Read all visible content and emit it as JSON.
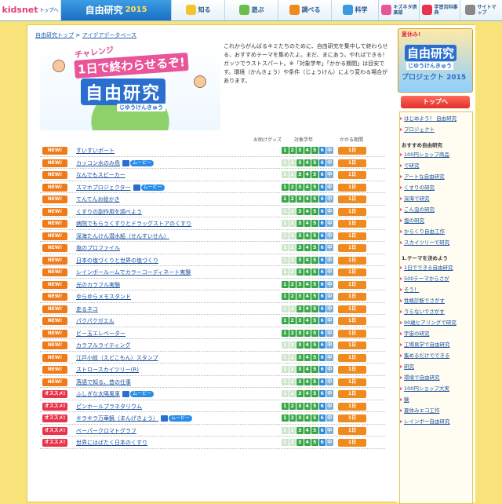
{
  "header": {
    "logo": "kidsnet",
    "logo_sub": "トップへ",
    "site_title": "自由研究",
    "site_year": "2015",
    "nav": [
      {
        "label": "知る",
        "icon": "book-icon",
        "color": "#f4c430"
      },
      {
        "label": "遊ぶ",
        "icon": "game-icon",
        "color": "#6abf4b"
      },
      {
        "label": "調べる",
        "icon": "search-icon",
        "color": "#f08a1e"
      },
      {
        "label": "科学",
        "icon": "flask-icon",
        "color": "#3a9be0"
      },
      {
        "label": "キズネタ倶楽部",
        "icon": "club-icon",
        "color": "#e85598"
      },
      {
        "label": "学習百科事典",
        "icon": "encyclopedia-icon",
        "color": "#e8334a"
      },
      {
        "label": "サイトマップ",
        "icon": "map-icon",
        "color": "#888888"
      }
    ]
  },
  "breadcrumb": {
    "home": "自由研究トップ",
    "sep": " > ",
    "current": "アイデアデータベース"
  },
  "banner": {
    "challenge": "チャレンジ",
    "line1": "1日で終わらせるぞ!",
    "line2": "自由研究",
    "ruby": "じゆうけんきゅう"
  },
  "intro": "これからがんばるキミたちのために、自由研究を集中して終わらせる、おすすめテーマを集めたよ。まだ、まにあう。やればできる！ ガッツでラストスパート。※「対象学年」「かかる期間」は目安です。環境（かんきょう）や条件（じょうけん）により変わる場合があります。",
  "columns": {
    "goods": "お助けグッズ",
    "grade": "対象学年",
    "period": "かかる期間"
  },
  "rows": [
    {
      "tag": "NEW!",
      "type": "new",
      "title": "すいすいボート",
      "movie": "",
      "grades": [
        1,
        2,
        3,
        4,
        5,
        6
      ],
      "period": "1日"
    },
    {
      "tag": "NEW!",
      "type": "new",
      "title": "カッコン水のみ鳥",
      "movie": "ムービー",
      "grades": [
        3,
        4,
        5,
        6
      ],
      "period": "1日"
    },
    {
      "tag": "NEW!",
      "type": "new",
      "title": "なんでもスピーカー",
      "movie": "",
      "grades": [
        3,
        4,
        5,
        6
      ],
      "period": "1日"
    },
    {
      "tag": "NEW!",
      "type": "new",
      "title": "スマホプロジェクター",
      "movie": "ムービー",
      "grades": [
        1,
        2,
        3,
        4,
        5,
        6
      ],
      "period": "1日"
    },
    {
      "tag": "NEW!",
      "type": "new",
      "title": "てんてんお絵かき",
      "movie": "",
      "grades": [
        1,
        2,
        3,
        4,
        5,
        6
      ],
      "period": "1日"
    },
    {
      "tag": "NEW!",
      "type": "new",
      "title": "くすりの副作用を調べよう",
      "movie": "",
      "grades": [
        3,
        4,
        5,
        6
      ],
      "period": "1日"
    },
    {
      "tag": "NEW!",
      "type": "new",
      "title": "病院でもらうくすりとドラッグストアのくすり",
      "movie": "",
      "grades": [
        3,
        4,
        5,
        6
      ],
      "period": "1日"
    },
    {
      "tag": "NEW!",
      "type": "new",
      "title": "深海たんけん潜水船（せんすいせん）",
      "movie": "",
      "grades": [
        3,
        4,
        5,
        6
      ],
      "period": "1日"
    },
    {
      "tag": "NEW!",
      "type": "new",
      "title": "塩のプロファイル",
      "movie": "",
      "grades": [
        3,
        4,
        5,
        6
      ],
      "period": "1日"
    },
    {
      "tag": "NEW!",
      "type": "new",
      "title": "日本の塩づくりと世界の塩づくり",
      "movie": "",
      "grades": [
        3,
        4,
        5,
        6
      ],
      "period": "1日"
    },
    {
      "tag": "NEW!",
      "type": "new",
      "title": "レインボールームでカラーコーディネート実験",
      "movie": "",
      "grades": [
        3,
        4,
        5,
        6
      ],
      "period": "1日"
    },
    {
      "tag": "NEW!",
      "type": "new",
      "title": "光のカラフル実験",
      "movie": "",
      "grades": [
        1,
        2,
        3,
        4,
        5,
        6
      ],
      "period": "1日"
    },
    {
      "tag": "NEW!",
      "type": "new",
      "title": "ゆらゆらメモスタンド",
      "movie": "",
      "grades": [
        1,
        2,
        3,
        4,
        5,
        6
      ],
      "period": "1日"
    },
    {
      "tag": "NEW!",
      "type": "new",
      "title": "走るネコ",
      "movie": "",
      "grades": [
        3,
        4,
        5,
        6
      ],
      "period": "1日"
    },
    {
      "tag": "NEW!",
      "type": "new",
      "title": "パクパクガエル",
      "movie": "",
      "grades": [
        1,
        2,
        3,
        4,
        5,
        6
      ],
      "period": "1日"
    },
    {
      "tag": "NEW!",
      "type": "new",
      "title": "ビー玉エレベーター",
      "movie": "",
      "grades": [
        1,
        2,
        3,
        4,
        5,
        6
      ],
      "period": "1日"
    },
    {
      "tag": "NEW!",
      "type": "new",
      "title": "カラフルライティング",
      "movie": "",
      "grades": [
        3,
        4,
        5,
        6
      ],
      "period": "1日"
    },
    {
      "tag": "NEW!",
      "type": "new",
      "title": "江戸小紋（えどこもん）スタンプ",
      "movie": "",
      "grades": [
        3,
        4,
        5,
        6
      ],
      "period": "1日"
    },
    {
      "tag": "NEW!",
      "type": "new",
      "title": "ストロースカイツリー(R)",
      "movie": "",
      "grades": [
        3,
        4,
        5,
        6
      ],
      "period": "1日"
    },
    {
      "tag": "NEW!",
      "type": "new",
      "title": "落語で知る、昔の仕事",
      "movie": "",
      "grades": [
        3,
        4,
        5,
        6
      ],
      "period": "1日"
    },
    {
      "tag": "オススメ!",
      "type": "oss",
      "title": "ふしぎな太陽風車",
      "movie": "ムービー",
      "grades": [
        3,
        4,
        5,
        6
      ],
      "period": "1日"
    },
    {
      "tag": "オススメ!",
      "type": "oss",
      "title": "ピンホールプラネタリウム",
      "movie": "",
      "grades": [
        1,
        2,
        3,
        4,
        5,
        6
      ],
      "period": "1日"
    },
    {
      "tag": "オススメ!",
      "type": "oss",
      "title": "キラキラ万華鏡（まんげきょう）",
      "movie": "ムービー",
      "grades": [
        1,
        2,
        3,
        4,
        5,
        6
      ],
      "period": "1日"
    },
    {
      "tag": "オススメ!",
      "type": "oss",
      "title": "ペーパークロマトグラフ",
      "movie": "",
      "grades": [
        3,
        4,
        5,
        6
      ],
      "period": "1日"
    },
    {
      "tag": "オススメ!",
      "type": "oss",
      "title": "世界にはばたく日本のくすり",
      "movie": "",
      "grades": [
        3,
        4,
        5,
        6
      ],
      "period": "1日"
    }
  ],
  "sidebar": {
    "promo_a": "夏休み!",
    "promo_b": "自由研究",
    "promo_c": "じゆうけんきゅう",
    "promo_d": "プロジェクト 2015",
    "top_button": "トップへ",
    "links1": [
      "はじめよう！ 自由研究",
      "プロジェクト"
    ],
    "heading1": "おすすめ自由研究",
    "links2": [
      "100円ショップ商品",
      "で研究",
      "アートな自由研究",
      "くすりの研究",
      "深海で研究",
      "こん虫の研究",
      "塩の研究",
      "からくり自由工作",
      "スカイツリーで研究"
    ],
    "heading2": "1.テーマを決めよう",
    "links3": [
      "1日でできる自由研究",
      "500テーマからさが",
      "そう！",
      "性格診断でさがす",
      "うらないでさがす",
      "90歳ヒアリングで研究",
      "宇宙の研究",
      "工場見学で自由研究",
      "集めるだけでできる",
      "研究",
      "環境で自由研究",
      "100円ショップ大実",
      "験",
      "夏休みエコ工作",
      "レインボー自由研究"
    ]
  }
}
